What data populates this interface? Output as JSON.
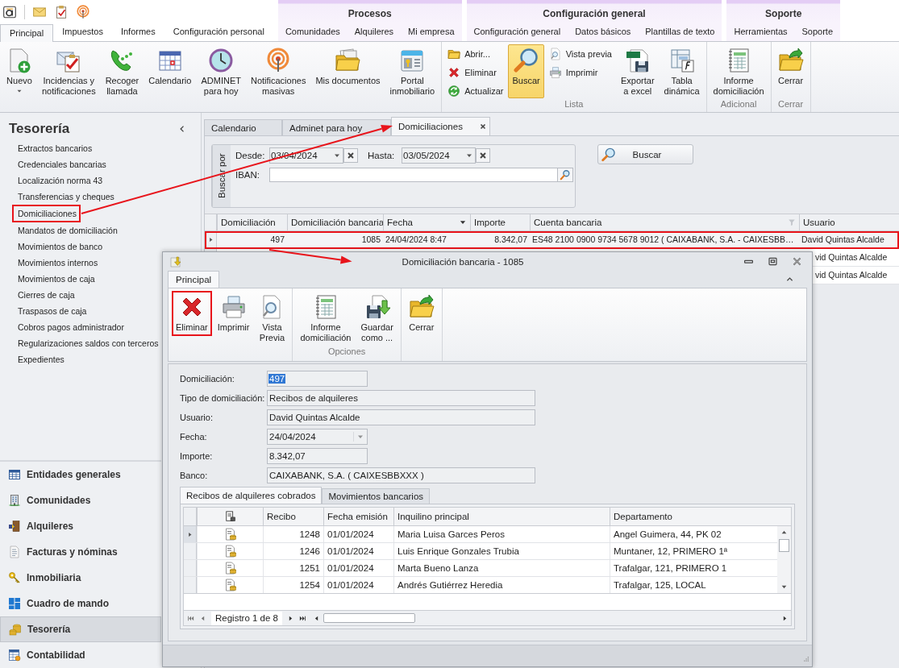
{
  "ribbon": {
    "tab_categories": [
      {
        "tabs": [
          {
            "label": "Principal",
            "selected": true
          },
          {
            "label": "Impuestos",
            "selected": false
          },
          {
            "label": "Informes",
            "selected": false
          },
          {
            "label": "Configuración personal",
            "selected": false
          }
        ]
      },
      {
        "title": "Procesos",
        "tabs": [
          {
            "label": "Comunidades",
            "selected": false
          },
          {
            "label": "Alquileres",
            "selected": false
          },
          {
            "label": "Mi empresa",
            "selected": false
          }
        ]
      },
      {
        "title": "Configuración general",
        "tabs": [
          {
            "label": "Configuración general",
            "selected": false
          },
          {
            "label": "Datos básicos",
            "selected": false
          },
          {
            "label": "Plantillas de texto",
            "selected": false
          }
        ]
      },
      {
        "title": "Soporte",
        "tabs": [
          {
            "label": "Herramientas",
            "selected": false
          },
          {
            "label": "Soporte",
            "selected": false
          }
        ]
      }
    ],
    "groups": [
      {
        "items": [
          {
            "kind": "large",
            "label": "Nuevo",
            "dropdown": true,
            "pressed": false
          },
          {
            "kind": "large",
            "label": "Incidencias y\nnotificaciones",
            "pressed": false
          },
          {
            "kind": "large",
            "label": "Recoger\nllamada",
            "pressed": false
          },
          {
            "kind": "large",
            "label": "Calendario",
            "pressed": false
          },
          {
            "kind": "large",
            "label": "ADMINET\npara hoy",
            "pressed": false
          },
          {
            "kind": "large",
            "label": "Notificaciones\nmasivas",
            "pressed": false
          },
          {
            "kind": "large",
            "label": "Mis documentos",
            "pressed": false
          },
          {
            "kind": "large",
            "label": "Portal\ninmobiliario",
            "pressed": false
          }
        ]
      },
      {
        "label": "Lista",
        "items": [
          {
            "kind": "stack",
            "buttons": [
              {
                "label": "Abrir...",
                "pressed": false
              },
              {
                "label": "Eliminar",
                "pressed": false
              },
              {
                "label": "Actualizar",
                "pressed": false
              }
            ]
          },
          {
            "kind": "large",
            "label": "Buscar",
            "pressed": true
          },
          {
            "kind": "stack",
            "buttons": [
              {
                "label": "Vista previa",
                "pressed": false
              },
              {
                "label": "Imprimir",
                "pressed": false
              }
            ]
          },
          {
            "kind": "large",
            "label": "Exportar\na excel",
            "pressed": false
          },
          {
            "kind": "large",
            "label": "Tabla\ndinámica",
            "pressed": false
          }
        ]
      },
      {
        "label": "Adicional",
        "items": [
          {
            "kind": "large",
            "label": "Informe\ndomiciliación",
            "pressed": false
          }
        ]
      },
      {
        "label": "Cerrar",
        "items": [
          {
            "kind": "large",
            "label": "Cerrar",
            "pressed": false
          }
        ]
      }
    ]
  },
  "sidebar": {
    "title": "Tesorería",
    "items": [
      {
        "label": "Extractos bancarios",
        "highlighted": false
      },
      {
        "label": "Credenciales bancarias",
        "highlighted": false
      },
      {
        "label": "Localización norma 43",
        "highlighted": false
      },
      {
        "label": "Transferencias y cheques",
        "highlighted": false
      },
      {
        "label": "Domiciliaciones",
        "highlighted": true
      },
      {
        "label": "Mandatos de domiciliación",
        "highlighted": false
      },
      {
        "label": "Movimientos de banco",
        "highlighted": false
      },
      {
        "label": "Movimientos internos",
        "highlighted": false
      },
      {
        "label": "Movimientos de caja",
        "highlighted": false
      },
      {
        "label": "Cierres de caja",
        "highlighted": false
      },
      {
        "label": "Traspasos de caja",
        "highlighted": false
      },
      {
        "label": "Cobros pagos administrador",
        "highlighted": false
      },
      {
        "label": "Regularizaciones saldos con terceros",
        "highlighted": false
      },
      {
        "label": "Expedientes",
        "highlighted": false
      }
    ],
    "nav": [
      {
        "label": "Entidades generales",
        "selected": false
      },
      {
        "label": "Comunidades",
        "selected": false
      },
      {
        "label": "Alquileres",
        "selected": false
      },
      {
        "label": "Facturas y nóminas",
        "selected": false
      },
      {
        "label": "Inmobiliaria",
        "selected": false
      },
      {
        "label": "Cuadro de mando",
        "selected": false
      },
      {
        "label": "Tesorería",
        "selected": true
      },
      {
        "label": "Contabilidad",
        "selected": false
      }
    ]
  },
  "document_tabs": [
    {
      "label": "Calendario",
      "selected": false
    },
    {
      "label": "Adminet para hoy",
      "selected": false
    },
    {
      "label": "Domiciliaciones",
      "selected": true,
      "closable": true
    }
  ],
  "filter": {
    "title": "Buscar por",
    "from": {
      "label": "Desde:",
      "value": "03/04/2024"
    },
    "to": {
      "label": "Hasta:",
      "value": "03/05/2024"
    },
    "iban": {
      "label": "IBAN:"
    },
    "search_button": "Buscar"
  },
  "table": {
    "columns": [
      {
        "label": "Domiciliación",
        "kind": "number"
      },
      {
        "label": "Domiciliación bancaria",
        "kind": "number"
      },
      {
        "label": "Fecha",
        "kind": "text",
        "sort_descending": true
      },
      {
        "label": "Importe",
        "kind": "number"
      },
      {
        "label": "Cuenta bancaria",
        "kind": "text",
        "filter": true
      },
      {
        "label": "Usuario",
        "kind": "text"
      }
    ],
    "rows": [
      {
        "selected": true,
        "highlighted": true,
        "cells": [
          "497",
          "1085",
          "24/04/2024 8:47",
          "8.342,07",
          "ES48 2100 0900 9734 5678 9012 ( CAIXABANK, S.A. - CAIXESBB…",
          "David Quintas Alcalde"
        ]
      },
      {
        "cells": [
          null,
          null,
          null,
          null,
          null,
          "vid Quintas Alcalde"
        ]
      },
      {
        "cells": [
          null,
          null,
          null,
          null,
          null,
          "vid Quintas Alcalde"
        ]
      }
    ]
  },
  "dialog": {
    "title": "Domiciliación bancaria - 1085",
    "tabs": [
      {
        "label": "Principal",
        "selected": true
      }
    ],
    "groups": [
      {
        "buttons": [
          {
            "label": "Eliminar",
            "highlighted": true
          },
          {
            "label": "Imprimir",
            "highlighted": false
          },
          {
            "label": "Vista\nPrevia",
            "highlighted": false
          }
        ]
      },
      {
        "label": "Opciones",
        "buttons": [
          {
            "label": "Informe\ndomiciliación",
            "highlighted": false
          },
          {
            "label": "Guardar\ncomo ...",
            "highlighted": false
          }
        ]
      },
      {
        "buttons": [
          {
            "label": "Cerrar",
            "highlighted": false
          }
        ]
      }
    ],
    "fields": [
      {
        "label": "Domiciliación:",
        "value": "497",
        "kind": "short",
        "text_selected": true
      },
      {
        "label": "Tipo de domiciliación:",
        "value": "Recibos de alquileres",
        "kind": "long",
        "text_selected": false
      },
      {
        "label": "Usuario:",
        "value": "David Quintas Alcalde",
        "kind": "long",
        "text_selected": false
      },
      {
        "label": "Fecha:",
        "value": "24/04/2024",
        "kind": "date",
        "text_selected": false
      },
      {
        "label": "Importe:",
        "value": "8.342,07",
        "kind": "short",
        "text_selected": false
      },
      {
        "label": "Banco:",
        "value": "CAIXABANK, S.A. ( CAIXESBBXXX )",
        "kind": "long",
        "text_selected": false
      }
    ],
    "detail_tabs": [
      {
        "label": "Recibos de alquileres cobrados",
        "selected": true
      },
      {
        "label": "Movimientos bancarios",
        "selected": false
      }
    ],
    "receipts": {
      "columns": [
        {
          "label": "Recibo",
          "kind": "number"
        },
        {
          "label": "Fecha emisión",
          "kind": "text"
        },
        {
          "label": "Inquilino principal",
          "kind": "text"
        },
        {
          "label": "Departamento",
          "kind": "text"
        }
      ],
      "rows": [
        {
          "selected": true,
          "cells": [
            "1248",
            "01/01/2024",
            "Maria Luisa Garces Peros",
            "Angel Guimera, 44, PK 02"
          ]
        },
        {
          "selected": false,
          "cells": [
            "1246",
            "01/01/2024",
            "Luis Enrique Gonzales Trubia",
            "Muntaner, 12, PRIMERO 1ª"
          ]
        },
        {
          "selected": false,
          "cells": [
            "1251",
            "01/01/2024",
            "Marta Bueno Lanza",
            "Trafalgar, 121, PRIMERO 1"
          ]
        },
        {
          "selected": false,
          "cells": [
            "1254",
            "01/01/2024",
            "Andrés Gutiérrez Heredia",
            "Trafalgar, 125, LOCAL"
          ]
        }
      ]
    },
    "navigator": {
      "record": "Registro 1 de 8"
    }
  }
}
